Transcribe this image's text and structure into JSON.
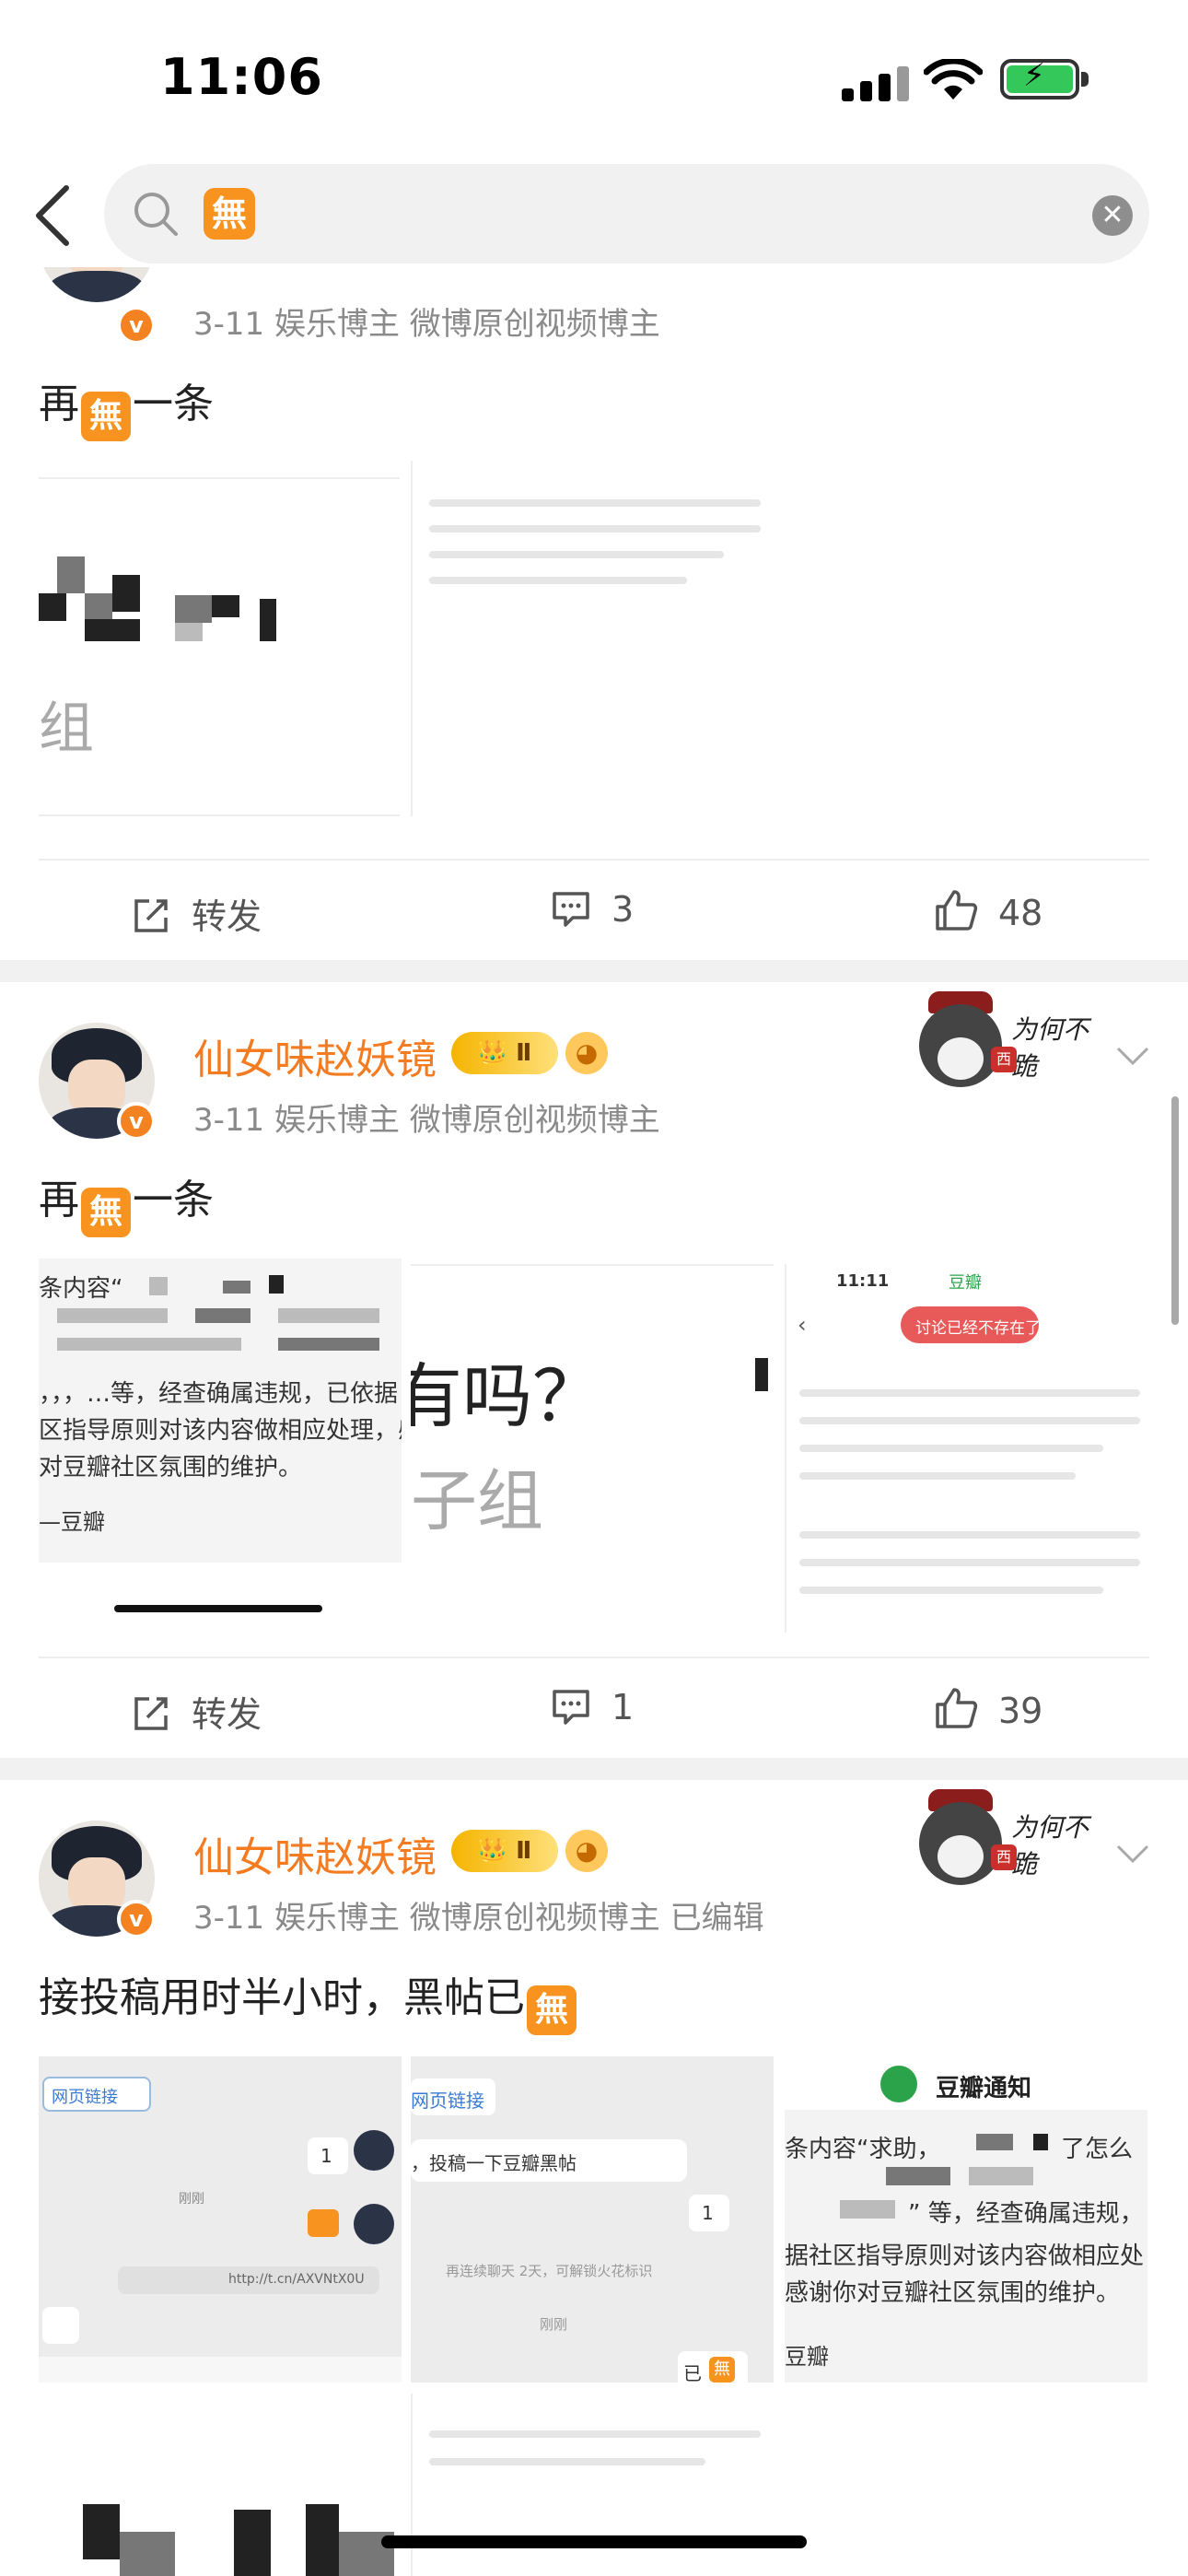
{
  "status": {
    "time": "11:06"
  },
  "search": {
    "query_glyph": "無",
    "clear_glyph": "✕"
  },
  "posts": [
    {
      "meta": "3-11  娱乐博主 微博原创视频博主",
      "text_before": "再",
      "text_emoji": "無",
      "text_after": "一条",
      "tile_texts": [
        "组"
      ],
      "actions": {
        "repost": "转发",
        "comments": "3",
        "likes": "48"
      }
    },
    {
      "username": "仙女味赵妖镜",
      "level_badge": "Ⅱ",
      "meta": "3-11  娱乐博主 微博原创视频博主",
      "decor_text": "为何不跪",
      "decor_stamp": "西皇",
      "text_before": "再",
      "text_emoji": "無",
      "text_after": "一条",
      "tiles": {
        "douban_notice_lines": [
          "条内容“",
          "，，，…等，经查确属违规，已依据",
          "区指导原则对该内容做相应处理，感",
          "对豆瓣社区氛围的维护。",
          "—豆瓣"
        ],
        "middle_text": "有吗？",
        "middle_sub": "子组",
        "phone_time": "11:11",
        "phone_app": "豆瓣",
        "phone_pill": "讨论已经不存在了"
      },
      "actions": {
        "repost": "转发",
        "comments": "1",
        "likes": "39"
      }
    },
    {
      "username": "仙女味赵妖镜",
      "level_badge": "Ⅱ",
      "meta": "3-11  娱乐博主 微博原创视频博主  已编辑",
      "decor_text": "为何不跪",
      "decor_stamp": "西皇",
      "text_before": "接投稿用时半小时，黑帖已",
      "text_emoji": "無",
      "tiles": {
        "chat1_link": "网页链接",
        "chat1_badge": "1",
        "chat1_time": "刚刚",
        "chat1_url": "http://t.cn/AXVNtX0U",
        "chat2_link": "网页链接",
        "chat2_msg": "，投稿一下豆瓣黑帖",
        "chat2_badge": "1",
        "chat2_notice": "再连续聊天 2天，可解锁火花标识",
        "chat2_time": "刚刚",
        "chat2_reply": "已",
        "chat2_reply_emoji": "無",
        "notice_title": "豆瓣通知",
        "notice_lines": [
          "条内容“求助，",
          "了怎么",
          "” 等，经查确属违规，",
          "据社区指导原则对该内容做相应处",
          "感谢你对豆瓣社区氛围的维护。",
          "豆瓣"
        ]
      }
    }
  ],
  "colors": {
    "accent": "#f57b20",
    "emoji_bg": "#f7931e",
    "verify": "#f58220",
    "pill": "#e85a5a"
  }
}
